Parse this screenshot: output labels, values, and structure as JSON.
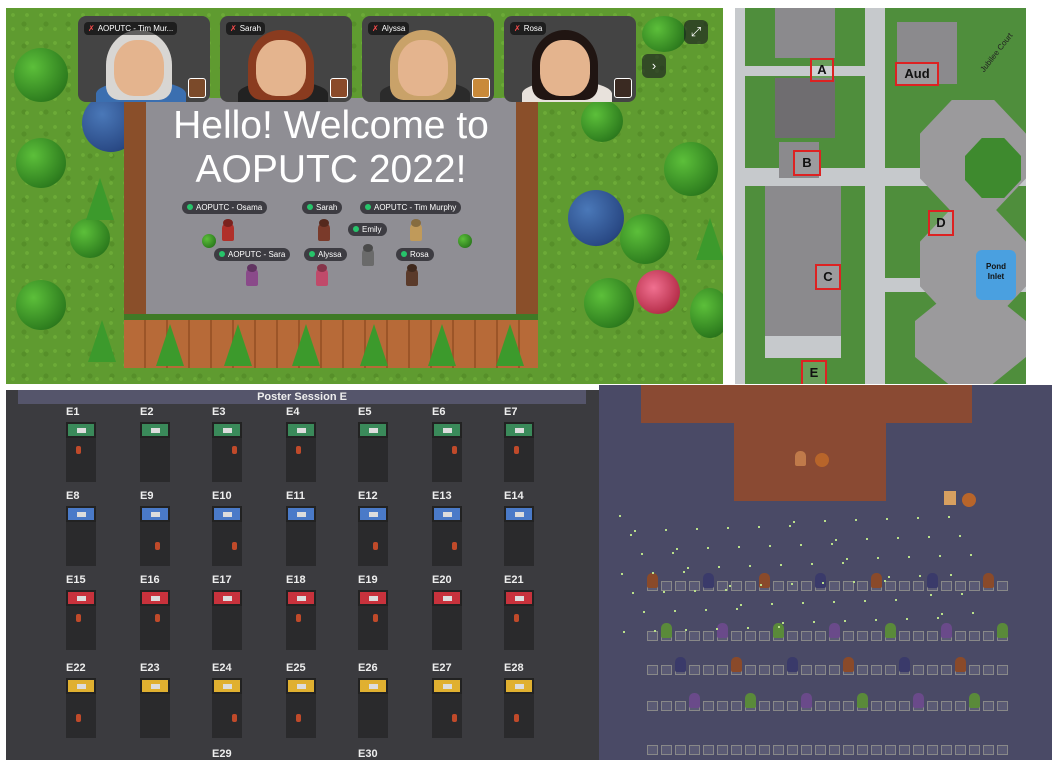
{
  "welcome_room": {
    "title_line1": "Hello! Welcome to",
    "title_line2": "AOPUTC 2022!",
    "video_tiles": [
      {
        "name": "AOPUTC - Tim Mur...",
        "hair_color": "#d8d6d3",
        "shirt_color": "#3b6fb0"
      },
      {
        "name": "Sarah",
        "hair_color": "#8a3b1f",
        "shirt_color": "#222222"
      },
      {
        "name": "Alyssa",
        "hair_color": "#c9a269",
        "shirt_color": "#2b2b2b"
      },
      {
        "name": "Rosa",
        "hair_color": "#201512",
        "shirt_color": "#e8e2dc"
      }
    ],
    "expand_icon": "expand-icon",
    "next_icon": "chevron-right-icon",
    "player_tags": [
      {
        "name": "AOPUTC - Osama"
      },
      {
        "name": "Sarah"
      },
      {
        "name": "AOPUTC - Tim Murphy"
      },
      {
        "name": "Emily"
      },
      {
        "name": "AOPUTC - Sara"
      },
      {
        "name": "Alyssa"
      },
      {
        "name": "Rosa"
      }
    ]
  },
  "campus_map": {
    "labels": [
      "A",
      "Aud",
      "B",
      "C",
      "D",
      "E"
    ],
    "road_name": "Jubilee Court",
    "pond_name_line1": "Pond",
    "pond_name_line2": "Inlet"
  },
  "poster_session": {
    "title": "Poster Session E",
    "rows": [
      {
        "color": "#3a8a5a",
        "booths": [
          "E1",
          "E2",
          "E3",
          "E4",
          "E5",
          "E6",
          "E7"
        ]
      },
      {
        "color": "#4a7ac8",
        "booths": [
          "E8",
          "E9",
          "E10",
          "E11",
          "E12",
          "E13",
          "E14"
        ]
      },
      {
        "color": "#c8323c",
        "booths": [
          "E15",
          "E16",
          "E17",
          "E18",
          "E19",
          "E20",
          "E21"
        ]
      },
      {
        "color": "#e0b030",
        "booths": [
          "E22",
          "E23",
          "E24",
          "E25",
          "E26",
          "E27",
          "E28"
        ]
      }
    ],
    "extra_booths": [
      "E29",
      "E30"
    ]
  },
  "colors": {
    "grass": "#5f9b30",
    "online_dot": "#27c46b",
    "map_label_border": "#dd2222"
  }
}
